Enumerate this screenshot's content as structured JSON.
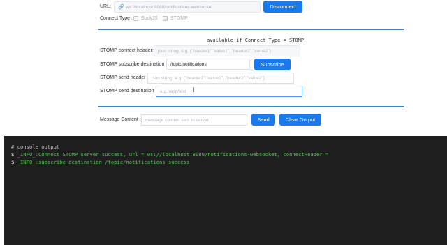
{
  "connection": {
    "url_label": "URL:",
    "url_value": "ws://localhost:8080/notifications-websocket",
    "disconnect_label": "Disconnect",
    "connect_type_label": "Connect Type :",
    "options": [
      {
        "label": "SockJS",
        "checked": false
      },
      {
        "label": "STOMP",
        "checked": true
      }
    ]
  },
  "stomp": {
    "availability_note": "available if Connect Type = STOMP",
    "connect_header_label": "STOMP connect header:",
    "connect_header_placeholder": "json string, e.g. {\"header1\":\"value1\", \"header2\":\"value2\"}",
    "subscribe_label": "STOMP subscribe destination :",
    "subscribe_value": "/topic/notifications",
    "subscribe_button": "Subscribe",
    "send_header_label": "STOMP send header :",
    "send_header_placeholder": "json string, e.g. {\"header1\":\"value1\", \"header2\":\"value2\"}",
    "send_dest_label": "STOMP send destination :",
    "send_dest_placeholder": "e.g. /app/test"
  },
  "message": {
    "label": "Message Content :",
    "placeholder": "message content sent to server",
    "send_button": "Send",
    "clear_button": "Clear Output"
  },
  "console": {
    "comment": "# console output",
    "lines": [
      "_INFO_:Connect STOMP server success, url = ws://localhost:8080/notifications-websocket, connectHeader =",
      "_INFO_:subscribe destination /topic/notifications success"
    ],
    "prompt": "$"
  },
  "colors": {
    "primary": "#1b79f0",
    "divider": "#3d84c4",
    "console_bg": "#1e1e1e",
    "console_text": "#4ccc4c"
  }
}
